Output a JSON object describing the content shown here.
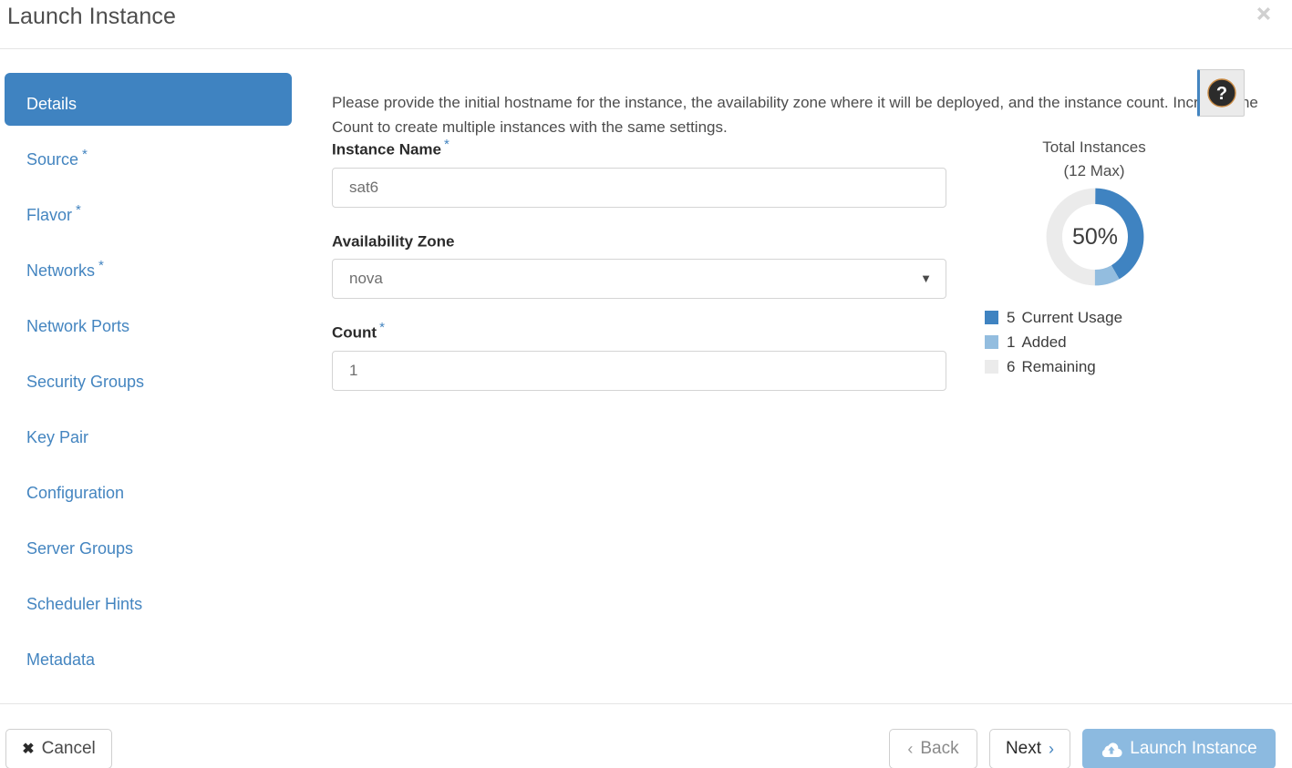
{
  "header": {
    "title": "Launch Instance",
    "close_icon": "close-icon"
  },
  "sidebar": {
    "items": [
      {
        "label": "Details",
        "required": "",
        "active": true
      },
      {
        "label": "Source",
        "required": "*",
        "active": false
      },
      {
        "label": "Flavor",
        "required": "*",
        "active": false
      },
      {
        "label": "Networks",
        "required": "*",
        "active": false
      },
      {
        "label": "Network Ports",
        "required": "",
        "active": false
      },
      {
        "label": "Security Groups",
        "required": "",
        "active": false
      },
      {
        "label": "Key Pair",
        "required": "",
        "active": false
      },
      {
        "label": "Configuration",
        "required": "",
        "active": false
      },
      {
        "label": "Server Groups",
        "required": "",
        "active": false
      },
      {
        "label": "Scheduler Hints",
        "required": "",
        "active": false
      },
      {
        "label": "Metadata",
        "required": "",
        "active": false
      }
    ]
  },
  "main": {
    "description": "Please provide the initial hostname for the instance, the availability zone where it will be deployed, and the instance count. Increase the Count to create multiple instances with the same settings.",
    "help_icon": "help-question-icon",
    "fields": {
      "instance_name": {
        "label": "Instance Name",
        "required": "*",
        "value": "sat6",
        "placeholder": "sat6"
      },
      "availability_zone": {
        "label": "Availability Zone",
        "required": "",
        "value": "nova",
        "options": [
          "nova"
        ],
        "caret_icon": "chevron-down-icon"
      },
      "count": {
        "label": "Count",
        "required": "*",
        "value": "1",
        "placeholder": "1"
      }
    }
  },
  "quota": {
    "title_line1": "Total Instances",
    "title_line2": "(12 Max)",
    "center_label": "50%",
    "legend": [
      {
        "value": "5",
        "label": "Current Usage",
        "color": "#3f83c1"
      },
      {
        "value": "1",
        "label": "Added",
        "color": "#93bddf"
      },
      {
        "value": "6",
        "label": "Remaining",
        "color": "#ebebeb"
      }
    ]
  },
  "chart_data": {
    "type": "pie",
    "title": "Total Instances (12 Max)",
    "categories": [
      "Current Usage",
      "Added",
      "Remaining"
    ],
    "values": [
      5,
      1,
      6
    ],
    "colors": [
      "#3f83c1",
      "#93bddf",
      "#ebebeb"
    ],
    "total": 12,
    "max": 12,
    "center_label": "50%",
    "percentages": [
      41.7,
      8.3,
      50.0
    ],
    "legend_position": "below",
    "donut": true
  },
  "footer": {
    "cancel": {
      "label": "Cancel",
      "icon": "x-icon"
    },
    "back": {
      "label": "Back",
      "icon": "chevron-left-icon"
    },
    "next": {
      "label": "Next",
      "icon": "chevron-right-icon"
    },
    "launch": {
      "label": "Launch Instance",
      "icon": "cloud-upload-icon",
      "color": "#8cbae0"
    }
  }
}
